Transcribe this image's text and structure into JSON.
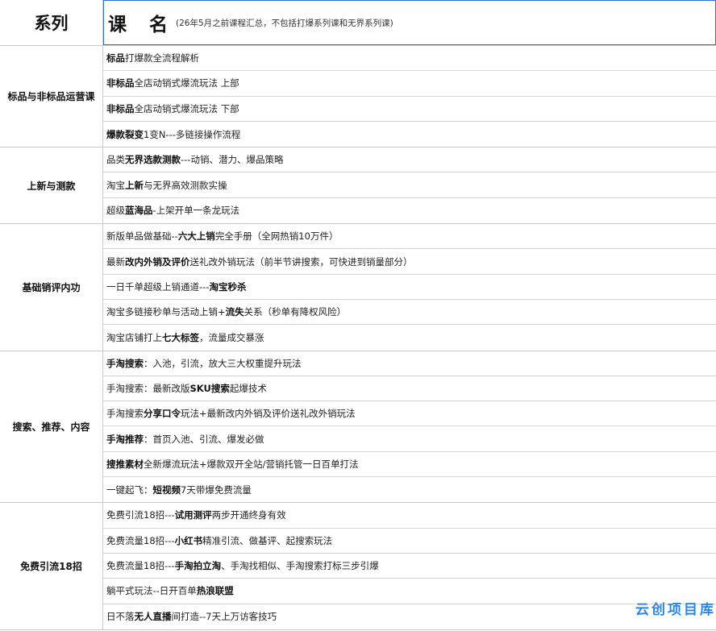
{
  "header": {
    "col1": "系列",
    "col2": "课 名",
    "note": "(26年5月之前课程汇总，不包括打爆系列课和无界系列课)"
  },
  "groups": [
    {
      "name": "标品与非标品运营课",
      "rows": [
        [
          {
            "t": "标品",
            "b": true
          },
          {
            "t": "打爆款全流程解析",
            "b": false
          }
        ],
        [
          {
            "t": "非标品",
            "b": true
          },
          {
            "t": "全店动销式爆流玩法    上部",
            "b": false
          }
        ],
        [
          {
            "t": "非标品",
            "b": true
          },
          {
            "t": "全店动销式爆流玩法     下部",
            "b": false
          }
        ],
        [
          {
            "t": "爆款裂变",
            "b": true
          },
          {
            "t": "1变N---多链接操作流程",
            "b": false
          }
        ]
      ]
    },
    {
      "name": "上新与测款",
      "rows": [
        [
          {
            "t": "品类",
            "b": false
          },
          {
            "t": "无界选款测款",
            "b": true
          },
          {
            "t": "---动销、潜力、爆品策略",
            "b": false
          }
        ],
        [
          {
            "t": "淘宝",
            "b": false
          },
          {
            "t": "上新",
            "b": true
          },
          {
            "t": "与无界高效测款实操",
            "b": false
          }
        ],
        [
          {
            "t": "超级",
            "b": false
          },
          {
            "t": "蓝海品",
            "b": true
          },
          {
            "t": "-上架开单一条龙玩法",
            "b": false
          }
        ]
      ]
    },
    {
      "name": "基础销评内功",
      "rows": [
        [
          {
            "t": "新版单品做基础--",
            "b": false
          },
          {
            "t": "六大上销",
            "b": true
          },
          {
            "t": "完全手册（全网热销10万件）",
            "b": false
          }
        ],
        [
          {
            "t": "最新",
            "b": false
          },
          {
            "t": "改内外销及评价",
            "b": true
          },
          {
            "t": "送礼改外销玩法（前半节讲搜索，可快进到销量部分）",
            "b": false
          }
        ],
        [
          {
            "t": "一日千单超级上销通道---",
            "b": false
          },
          {
            "t": "淘宝秒杀",
            "b": true
          }
        ],
        [
          {
            "t": "淘宝多链接秒单与活动上销+",
            "b": false
          },
          {
            "t": "流失",
            "b": true
          },
          {
            "t": "关系（秒单有降权风险）",
            "b": false
          }
        ],
        [
          {
            "t": "淘宝店铺打上",
            "b": false
          },
          {
            "t": "七大标签",
            "b": true
          },
          {
            "t": "，流量成交暴涨",
            "b": false
          }
        ]
      ]
    },
    {
      "name": "搜索、推荐、内容",
      "rows": [
        [
          {
            "t": "手淘搜索",
            "b": true
          },
          {
            "t": "：入池，引流，放大三大权重提升玩法",
            "b": false
          }
        ],
        [
          {
            "t": "手淘搜索：最新改版",
            "b": false
          },
          {
            "t": "SKU搜索",
            "b": true
          },
          {
            "t": "起爆技术",
            "b": false
          }
        ],
        [
          {
            "t": "手淘搜索",
            "b": false
          },
          {
            "t": "分享口令",
            "b": true
          },
          {
            "t": "玩法+最新改内外销及评价送礼改外销玩法",
            "b": false
          }
        ],
        [
          {
            "t": "手淘推荐",
            "b": true
          },
          {
            "t": "：首页入池、引流、爆发必做",
            "b": false
          }
        ],
        [
          {
            "t": "搜推素材",
            "b": true
          },
          {
            "t": "全新爆流玩法+爆款双开全站/营销托管一日百单打法",
            "b": false
          }
        ],
        [
          {
            "t": "一键起飞：",
            "b": false
          },
          {
            "t": "短视频",
            "b": true
          },
          {
            "t": "7天带爆免费流量",
            "b": false
          }
        ]
      ]
    },
    {
      "name": "免费引流18招",
      "rows": [
        [
          {
            "t": "免费引流18招---",
            "b": false
          },
          {
            "t": "试用测评",
            "b": true
          },
          {
            "t": "两步开通终身有效",
            "b": false
          }
        ],
        [
          {
            "t": "免费流量18招---",
            "b": false
          },
          {
            "t": "小红书",
            "b": true
          },
          {
            "t": "精准引流、做基评、起搜索玩法",
            "b": false
          }
        ],
        [
          {
            "t": "免费流量18招---",
            "b": false
          },
          {
            "t": "手淘拍立淘",
            "b": true
          },
          {
            "t": "、手淘找相似、手淘搜索打标三步引爆",
            "b": false
          }
        ],
        [
          {
            "t": "躺平式玩法--日开百单",
            "b": false
          },
          {
            "t": "热浪联盟",
            "b": true
          }
        ],
        [
          {
            "t": "日不落",
            "b": false
          },
          {
            "t": "无人直播",
            "b": true
          },
          {
            "t": "间打造--7天上万访客技巧",
            "b": false
          }
        ]
      ]
    }
  ],
  "watermark": "云创项目库"
}
